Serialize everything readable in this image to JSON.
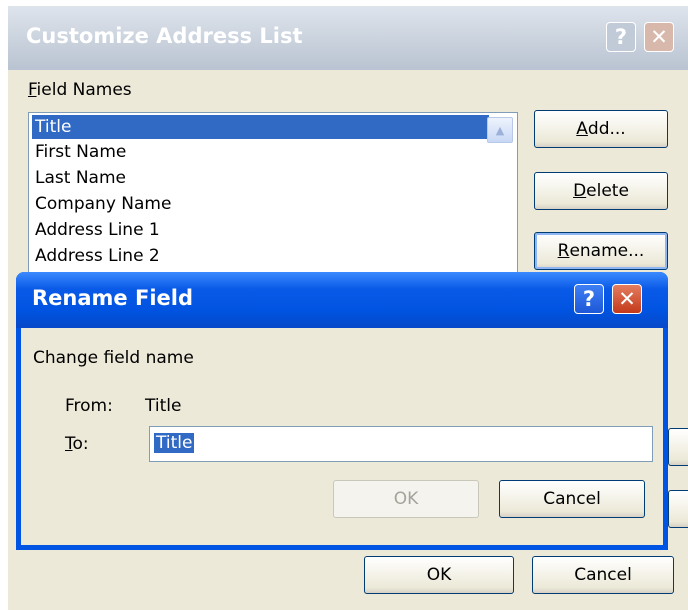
{
  "outer_dialog": {
    "title": "Customize Address List",
    "field_names_label": "Field Names",
    "fields": [
      "Title",
      "First Name",
      "Last Name",
      "Company Name",
      "Address Line 1",
      "Address Line 2"
    ],
    "add_button": "Add...",
    "delete_button": "Delete",
    "rename_button": "Rename...",
    "ok_button": "OK",
    "cancel_button": "Cancel"
  },
  "rename_dialog": {
    "title": "Rename Field",
    "prompt": "Change field name",
    "from_label": "From:",
    "from_value": "Title",
    "to_label": "To:",
    "to_value": "Title",
    "ok_button": "OK",
    "cancel_button": "Cancel"
  },
  "icons": {
    "help": "help-icon",
    "close": "close-icon",
    "scroll_up": "scroll-up-arrow-icon"
  },
  "colors": {
    "selection": "#316ac5",
    "title_bar_active": "#0054e3",
    "dialog_face": "#ece9d8"
  }
}
